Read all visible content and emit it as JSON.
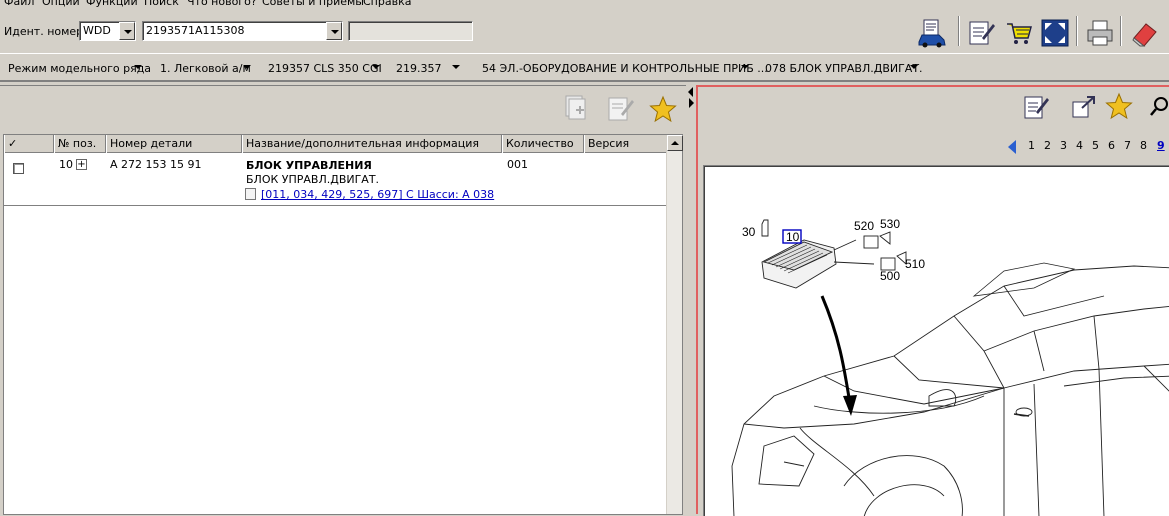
{
  "menu": [
    "Файл",
    "Опции",
    "Функции",
    "Поиск",
    "Что нового?",
    "Советы и приемы",
    "Справка"
  ],
  "toolbar": {
    "ident_label": "Идент. номер",
    "ident_prefix": "WDD",
    "ident_value": "2193571A115308",
    "ident_extra": ""
  },
  "breadcrumbs": [
    "Режим модельного ряда",
    "1. Легковой а/м",
    "219357 CLS 350 CGI",
    "219.357",
    "54 ЭЛ.-ОБОРУДОВАНИЕ И КОНТРОЛЬНЫЕ ПРИБ ...",
    "078 БЛОК УПРАВЛ.ДВИГАТ."
  ],
  "table": {
    "columns": [
      "✓",
      "№ поз.",
      "Номер детали",
      "Название/дополнительная информация",
      "Количество",
      "Версия"
    ],
    "rows": [
      {
        "pos": "10",
        "part_number": "A 272 153 15 91",
        "name": "БЛОК УПРАВЛЕНИЯ",
        "sub_name": "БЛОК УПРАВЛ.ДВИГАТ.",
        "info_link": "[011, 034, 429, 525, 697] С Шасси: A 038",
        "quantity": "001",
        "version": ""
      }
    ]
  },
  "pager": {
    "pages": [
      "1",
      "2",
      "3",
      "4",
      "5",
      "6",
      "7",
      "8",
      "9"
    ],
    "current": "9"
  },
  "drawing": {
    "callouts": [
      "30",
      "10",
      "520",
      "530",
      "500",
      "510"
    ]
  },
  "colors": {
    "window_bg": "#d4d0c8",
    "link": "#0000c0",
    "active_border": "#e06060",
    "star": "#f0c020"
  }
}
